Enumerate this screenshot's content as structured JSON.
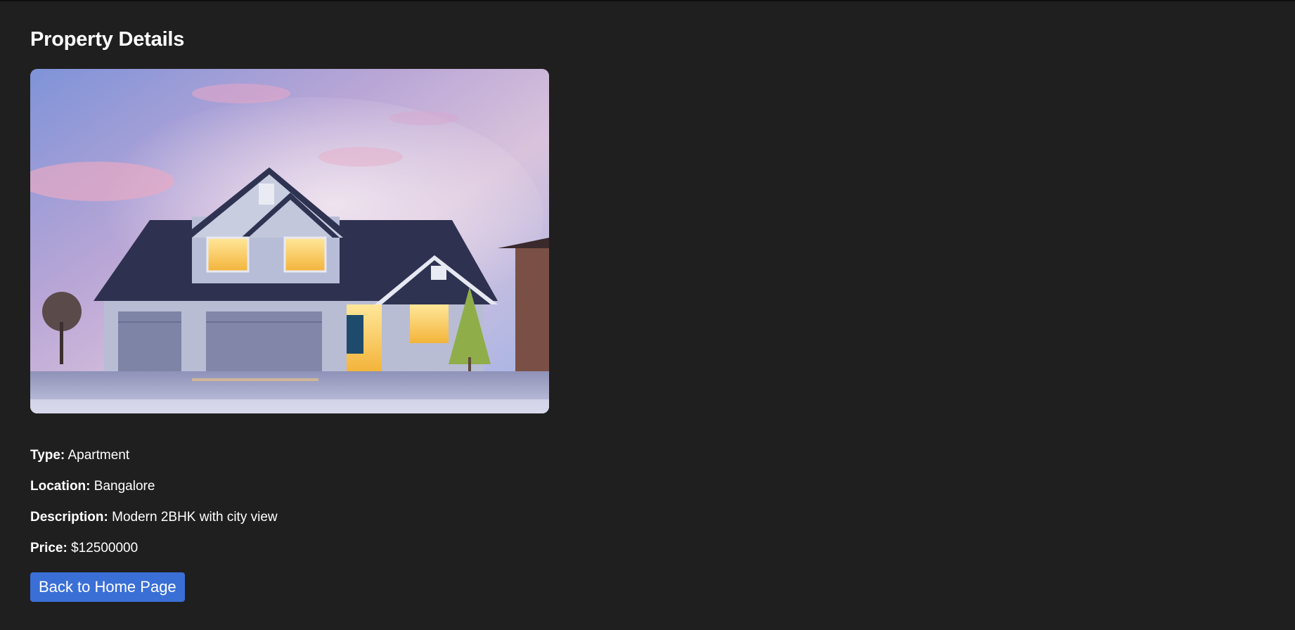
{
  "page": {
    "title": "Property Details"
  },
  "property": {
    "image_alt": "Property image",
    "fields": [
      {
        "label": "Type:",
        "value": "Apartment"
      },
      {
        "label": "Location:",
        "value": "Bangalore"
      },
      {
        "label": "Description:",
        "value": "Modern 2BHK with city view"
      },
      {
        "label": "Price:",
        "value": "$12500000"
      }
    ]
  },
  "actions": {
    "back_label": "Back to Home Page"
  },
  "colors": {
    "background": "#1f1f1f",
    "text": "#ffffff",
    "button": "#3a6fd6"
  }
}
